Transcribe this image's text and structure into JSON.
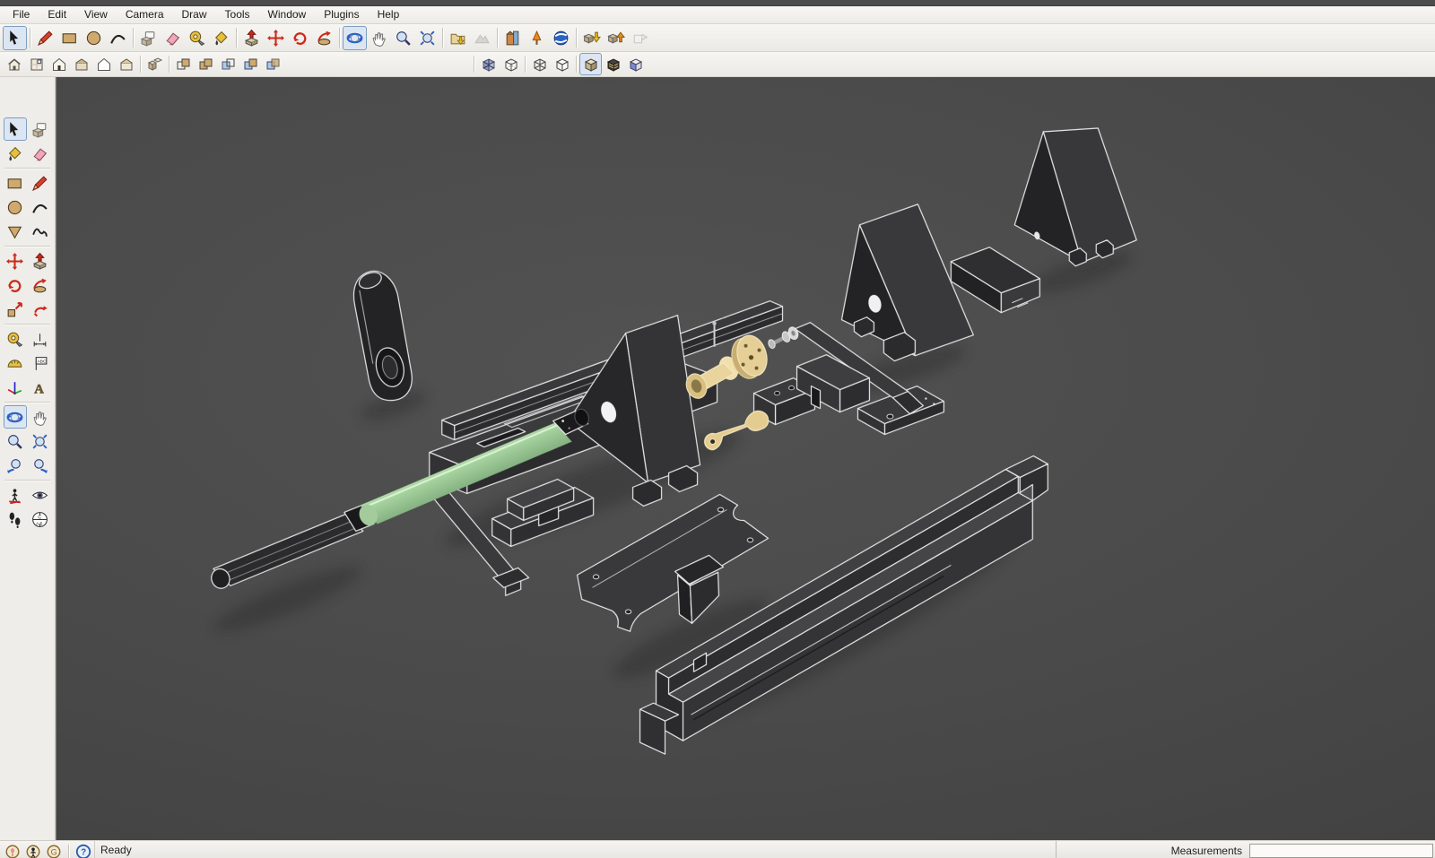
{
  "menu": {
    "items": [
      "File",
      "Edit",
      "View",
      "Camera",
      "Draw",
      "Tools",
      "Window",
      "Plugins",
      "Help"
    ]
  },
  "toolbar_main": {
    "groups": [
      [
        "select"
      ],
      [
        "line",
        "rectangle",
        "circle",
        "arc"
      ],
      [
        "make-component",
        "eraser",
        "tape-measure",
        "paint-bucket"
      ],
      [
        "push-pull",
        "move",
        "rotate",
        "follow-me"
      ],
      [
        "orbit",
        "pan",
        "zoom",
        "zoom-extents"
      ],
      [
        "add-location",
        "toggle-terrain"
      ],
      [
        "get-models",
        "photo-textures",
        "preview-google-earth"
      ],
      [
        "warehouse-get-models",
        "warehouse-share-models",
        "share-component"
      ]
    ],
    "active": [
      "select",
      "orbit"
    ],
    "disabled": [
      "toggle-terrain",
      "share-component"
    ]
  },
  "toolbar_secondary": {
    "groups": [
      [
        "view-iso",
        "view-top",
        "view-front",
        "view-right",
        "view-back",
        "view-left"
      ],
      [
        "outer-shell"
      ],
      [
        "intersect",
        "union",
        "subtract",
        "trim",
        "split"
      ],
      [
        "spacer"
      ],
      [
        "xray",
        "back-edges"
      ],
      [
        "wireframe",
        "hidden-line"
      ],
      [
        "shaded",
        "shaded-with-textures",
        "monochrome"
      ]
    ],
    "active": [
      "shaded"
    ],
    "disabled": []
  },
  "palette": {
    "rows": [
      [
        "select",
        "make-component"
      ],
      [
        "paint-bucket",
        "eraser"
      ],
      [
        "rectangle",
        "line"
      ],
      [
        "circle",
        "arc"
      ],
      [
        "polygon",
        "freehand"
      ],
      [
        "move",
        "push-pull"
      ],
      [
        "rotate",
        "follow-me"
      ],
      [
        "scale",
        "offset"
      ],
      [
        "tape-measure",
        "dimension"
      ],
      [
        "protractor",
        "text"
      ],
      [
        "axes",
        "3d-text"
      ],
      [
        "orbit",
        "pan"
      ],
      [
        "zoom",
        "zoom-extents"
      ],
      [
        "zoom-previous",
        "zoom-next"
      ],
      [
        "position-camera",
        "look-around"
      ],
      [
        "walk",
        "section-plane"
      ]
    ],
    "dividers_after": [
      1,
      4,
      7,
      10,
      13
    ],
    "active": [
      "select",
      "orbit"
    ]
  },
  "statusbar": {
    "icons": [
      "geolocation",
      "claim-credit",
      "sign-in"
    ],
    "help_icon": "help",
    "ready": "Ready",
    "measurements_label": "Measurements",
    "measurements_value": ""
  },
  "viewport": {
    "background": "#4a4a4a",
    "edge_color": "#e8e8e8",
    "part_fill": "#323234",
    "accent_green": "#b5e0ae",
    "accent_tan": "#e6cf96",
    "parts": [
      "strap",
      "tool-rest-base",
      "headstock-bracket",
      "handle-rod",
      "support-bar",
      "tool-rest-top",
      "clamp-assembly",
      "tailstock-bracket",
      "wedge-block",
      "tailstock-bracket-2",
      "mounting-plate",
      "bed-rail",
      "bushing",
      "flange-disc",
      "screw",
      "lever-cam"
    ]
  }
}
